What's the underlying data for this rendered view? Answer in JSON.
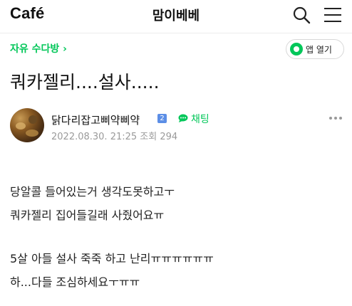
{
  "header": {
    "logo": "Café",
    "cafe_name": "맘이베베",
    "search_icon": "search-icon",
    "menu_icon": "hamburger-menu-icon"
  },
  "board": {
    "name": "자유 수다방 ›",
    "app_open_label": "앱 열기",
    "accent": "#03c75a"
  },
  "post": {
    "title": "쿼카젤리....설사.....",
    "author": "닭다리잡고삐약삐약",
    "grade": "2",
    "chat_label": "채팅",
    "meta": "2022.08.30. 21:25 조회 294",
    "body": [
      "당알콜 들어있는거 생각도못하고ㅜ",
      "쿼카젤리 집어들길래 사줬어요ㅠ",
      "5살 아들 설사 죽죽 하고 난리ㅠㅠㅠㅠㅠㅠ",
      "하...다들 조심하세요ㅜㅠㅠ"
    ]
  }
}
